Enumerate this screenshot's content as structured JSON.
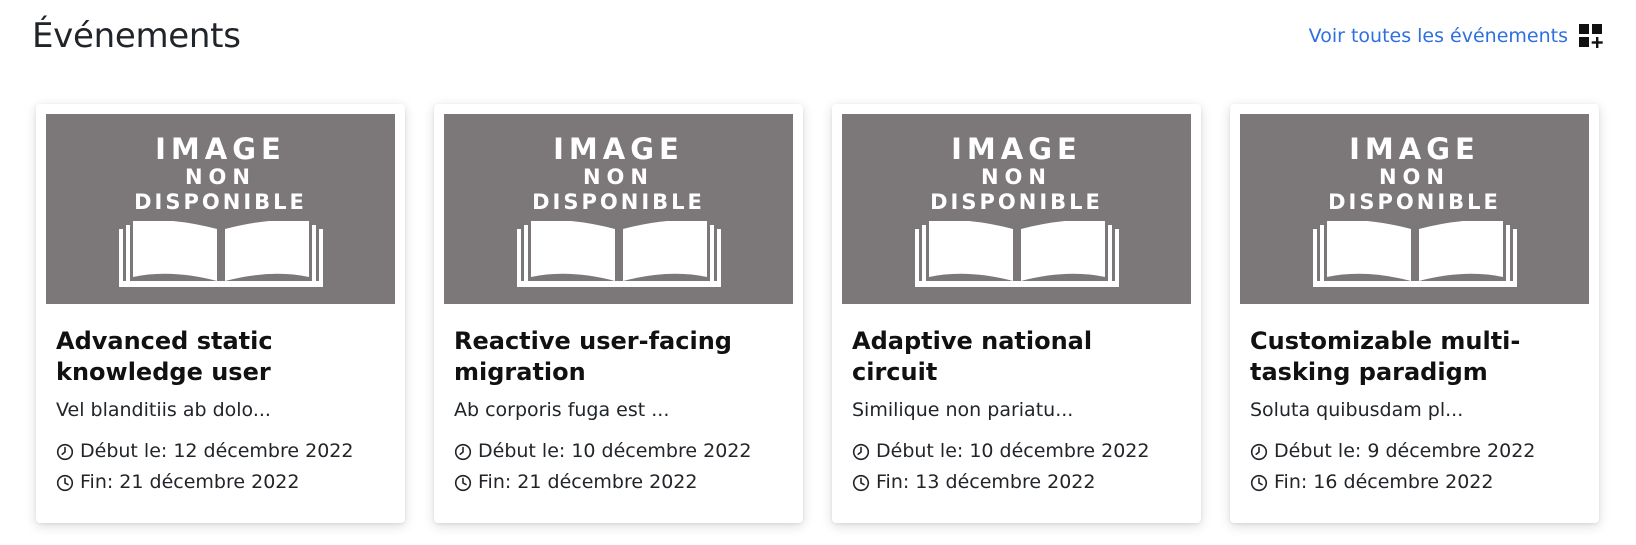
{
  "header": {
    "title": "Événements",
    "see_all_label": "Voir toutes les événements"
  },
  "colors": {
    "link": "#2f6fe0",
    "placeholder_bg": "#7c7879"
  },
  "placeholder_image": {
    "line1": "IMAGE",
    "line2": "NON",
    "line3": "DISPONIBLE"
  },
  "events": [
    {
      "title": "Advanced static knowledge user",
      "excerpt": "Vel blanditiis ab dolo...",
      "start": "Début le: 12 décembre 2022",
      "end": "Fin: 21 décembre 2022"
    },
    {
      "title": "Reactive user-facing migration",
      "excerpt": "Ab corporis fuga est ...",
      "start": "Début le: 10 décembre 2022",
      "end": "Fin: 21 décembre 2022"
    },
    {
      "title": "Adaptive national circuit",
      "excerpt": "Similique non pariatu...",
      "start": "Début le: 10 décembre 2022",
      "end": "Fin: 13 décembre 2022"
    },
    {
      "title": "Customizable multi-tasking paradigm",
      "excerpt": "Soluta quibusdam pl...",
      "start": "Début le: 9 décembre 2022",
      "end": "Fin: 16 décembre 2022"
    }
  ]
}
